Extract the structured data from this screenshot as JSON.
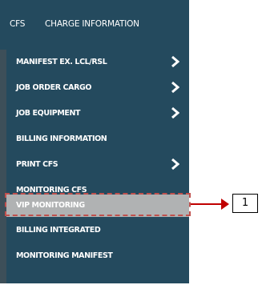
{
  "header": {
    "tabs": [
      {
        "label": "CFS"
      },
      {
        "label": "CHARGE INFORMATION"
      }
    ]
  },
  "menu": {
    "items": [
      {
        "label": "MANIFEST EX. LCL/RSL",
        "has_submenu": true,
        "icon": "chevron-right-icon"
      },
      {
        "label": "JOB ORDER CARGO",
        "has_submenu": true,
        "icon": "chevron-right-icon"
      },
      {
        "label": "JOB EQUIPMENT",
        "has_submenu": true,
        "icon": "chevron-right-icon"
      },
      {
        "label": "BILLING INFORMATION",
        "has_submenu": false
      },
      {
        "label": "PRINT CFS",
        "has_submenu": true,
        "icon": "chevron-right-icon"
      },
      {
        "label": "MONITORING CFS",
        "has_submenu": false
      },
      {
        "label": "VIP MONITORING",
        "has_submenu": false,
        "active": true
      },
      {
        "label": "BILLING INTEGRATED",
        "has_submenu": false
      },
      {
        "label": "MONITORING MANIFEST",
        "has_submenu": false
      }
    ]
  },
  "annotation": {
    "callout_number": "1"
  },
  "colors": {
    "menu_bg": "#244a5e",
    "active_bg": "#b0b2b3",
    "highlight": "#c0504d",
    "arrow": "#c00000"
  }
}
